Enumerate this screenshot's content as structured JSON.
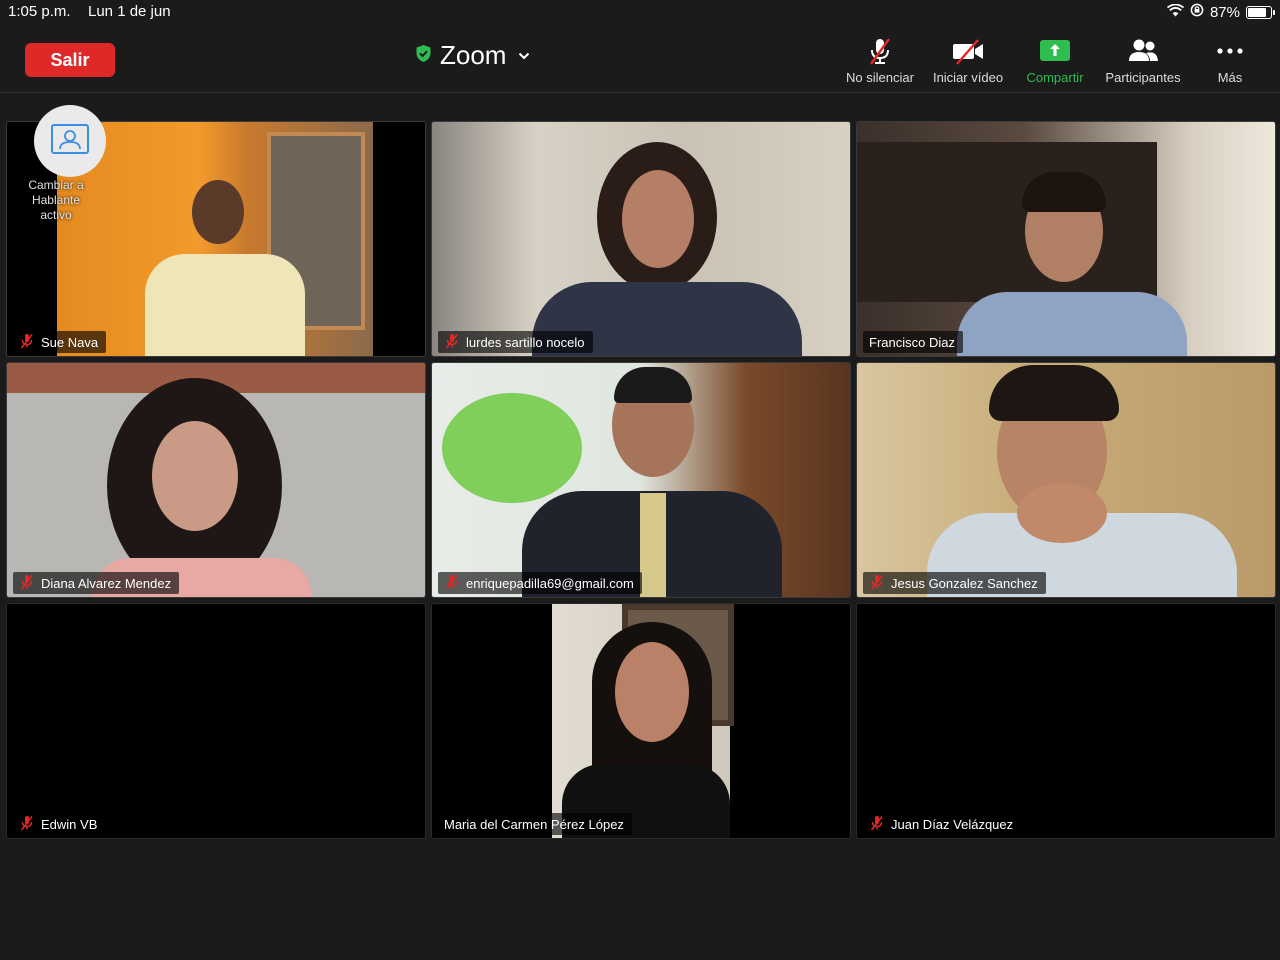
{
  "status_bar": {
    "time": "1:05 p.m.",
    "date": "Lun 1 de jun",
    "battery": "87%",
    "icons": [
      "wifi-icon",
      "rotation-lock-icon",
      "battery-icon"
    ]
  },
  "toolbar": {
    "leave_label": "Salir",
    "app_title": "Zoom",
    "items": [
      {
        "label": "No silenciar",
        "icon": "microphone-muted-icon"
      },
      {
        "label": "Iniciar vídeo",
        "icon": "video-off-icon"
      },
      {
        "label": "Compartir",
        "icon": "share-screen-icon"
      },
      {
        "label": "Participantes",
        "icon": "participants-icon"
      },
      {
        "label": "Más",
        "icon": "more-icon"
      }
    ],
    "accent_share": "#2ebd4e",
    "leave_color": "#e02828"
  },
  "spotlight": {
    "label_line1": "Cambiar a",
    "label_line2": "Hablante",
    "label_line3": "activo"
  },
  "participants": [
    {
      "name": "Sue Nava",
      "muted": true,
      "video": true
    },
    {
      "name": "lurdes sartillo nocelo",
      "muted": true,
      "video": true
    },
    {
      "name": "Francisco Diaz",
      "muted": false,
      "video": true
    },
    {
      "name": "Diana Alvarez Mendez",
      "muted": true,
      "video": true
    },
    {
      "name": "enriquepadilla69@gmail.com",
      "muted": true,
      "video": true
    },
    {
      "name": "Jesus Gonzalez Sanchez",
      "muted": true,
      "video": true
    },
    {
      "name": "Edwin VB",
      "muted": true,
      "video": false
    },
    {
      "name": "Maria del Carmen Pérez López",
      "muted": false,
      "video": true
    },
    {
      "name": "Juan Díaz Velázquez",
      "muted": true,
      "video": false
    }
  ]
}
